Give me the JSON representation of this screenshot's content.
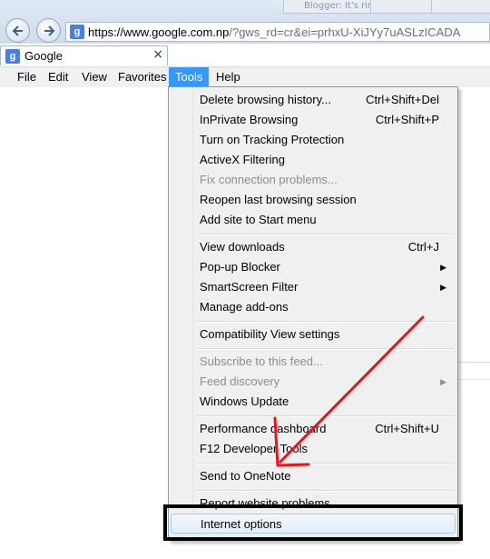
{
  "browser": {
    "url_domain": "https://www.google.com.np",
    "url_path": "/?gws_rd=cr&ei=prhxU-XiJYy7uASLzICADA",
    "ghost_tab_label": "Blogger: It's rindus",
    "active_tab": {
      "title": "Google",
      "favicon": "google-g-icon"
    },
    "nav_icons": {
      "back": "back-arrow-icon",
      "forward": "forward-arrow-icon"
    }
  },
  "menubar": {
    "items": [
      {
        "label": "File"
      },
      {
        "label": "Edit"
      },
      {
        "label": "View"
      },
      {
        "label": "Favorites"
      },
      {
        "label": "Tools"
      },
      {
        "label": "Help"
      }
    ]
  },
  "tools_menu": {
    "items": [
      {
        "label": "Delete browsing history...",
        "shortcut": "Ctrl+Shift+Del",
        "enabled": true
      },
      {
        "label": "InPrivate Browsing",
        "shortcut": "Ctrl+Shift+P",
        "enabled": true
      },
      {
        "label": "Turn on Tracking Protection",
        "shortcut": "",
        "enabled": true
      },
      {
        "label": "ActiveX Filtering",
        "shortcut": "",
        "enabled": true
      },
      {
        "label": "Fix connection problems...",
        "shortcut": "",
        "enabled": false
      },
      {
        "label": "Reopen last browsing session",
        "shortcut": "",
        "enabled": true
      },
      {
        "label": "Add site to Start menu",
        "shortcut": "",
        "enabled": true
      },
      {
        "label": "View downloads",
        "shortcut": "Ctrl+J",
        "enabled": true
      },
      {
        "label": "Pop-up Blocker",
        "shortcut": "",
        "enabled": true,
        "submenu": true
      },
      {
        "label": "SmartScreen Filter",
        "shortcut": "",
        "enabled": true,
        "submenu": true
      },
      {
        "label": "Manage add-ons",
        "shortcut": "",
        "enabled": true
      },
      {
        "label": "Compatibility View settings",
        "shortcut": "",
        "enabled": true
      },
      {
        "label": "Subscribe to this feed...",
        "shortcut": "",
        "enabled": false
      },
      {
        "label": "Feed discovery",
        "shortcut": "",
        "enabled": false,
        "submenu": true
      },
      {
        "label": "Windows Update",
        "shortcut": "",
        "enabled": true
      },
      {
        "label": "Performance dashboard",
        "shortcut": "Ctrl+Shift+U",
        "enabled": true
      },
      {
        "label": "F12 Developer Tools",
        "shortcut": "",
        "enabled": true
      },
      {
        "label": "Send to OneNote",
        "shortcut": "",
        "enabled": true
      },
      {
        "label": "Report website problems",
        "shortcut": "",
        "enabled": true
      },
      {
        "label": "Internet options",
        "shortcut": "",
        "enabled": true,
        "highlighted": true
      }
    ]
  },
  "colors": {
    "menubar_active": "#3399ff",
    "annotation_arrow": "#e8141d",
    "annotation_box": "#000000"
  }
}
